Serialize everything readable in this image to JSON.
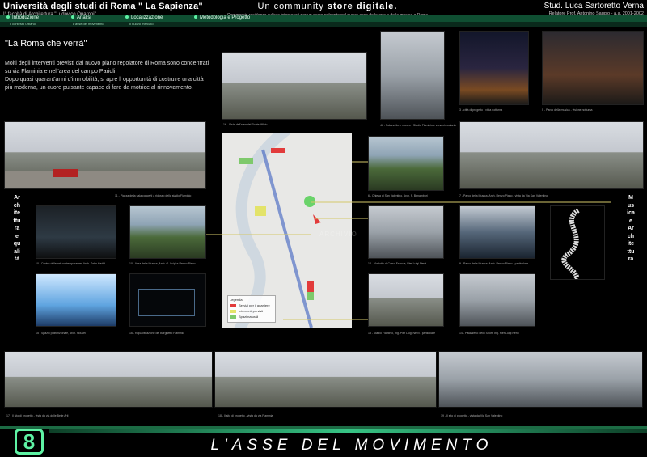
{
  "header": {
    "university": "Università degli studi di Roma \" La Sapienza\"",
    "faculty": "I° facoltà di Architettura \"Ludovico Quaroni\"",
    "center_title_a": "Un community ",
    "center_title_b": "store digitale.",
    "center_desc": "Commercio residenza cultura intersecati per un cuore pulsante nel nuovo asse delle arte e della musica a Roma",
    "author": "Stud. Luca Sartoretto Verna",
    "relatore": "Relatore Prof. Antonino Saggio - a.a. 2001-2002"
  },
  "nav": {
    "items": [
      {
        "label": "Introduzione"
      },
      {
        "label": "Analisi"
      },
      {
        "label": "Localizzazione"
      },
      {
        "label": "Metodologia e Progetto"
      }
    ],
    "sub": [
      "Il contesto urbano",
      "L'asse del movimento",
      "Il nuovo mercato"
    ]
  },
  "main": {
    "title": "\"La Roma che verrà\"",
    "p1": "Molti degli interventi previsti dal nuovo piano regolatore di Roma sono concentrati su via Flaminia e nell'area del campo Parioli.",
    "p2": "Dopo quasi quarant'anni d'immobilità, si apre l' opportunità di costruire una città più moderna, un cuore pulsante capace di fare da motrice al rinnovamento."
  },
  "side": {
    "left_text": "Architettura e qualità",
    "right_text": "Musica e Architettura"
  },
  "captions": {
    "c1": "1b - Vista dell'area del Ponte Milvio",
    "c2": "4b - Palazzetto e museo - Stadio Flaminio e zona circostante",
    "c3": "3 - città di progetto - vista notturna",
    "c4": "5 - Parco della musica - visione notturna",
    "c5": "11 - Piazza della sala concerti a ridosso della stadio Flaminio",
    "c6": "6 - Chiesa di San Valentino, Arch. F. Benamburi",
    "c7": "7 - Parco della Musica, Arch. Renzo Piano - vista da Via San Valentino",
    "c8": "8 - Ponte della Musica, Arch. Zaha Hadid",
    "c9": "9 - Parco della Musica, Arch. Renzo Piano - particolare",
    "c10": "10 - Centro delle arti contemporanee, Arch. Zaha Hadid",
    "c11": "10 - Area della Musica, Arch. O. Luigi e Renzo Piano",
    "c12": "12 - Viadotto di Corso Francia, Pier Luigi Nervi",
    "c13": "13 - Stadio Flaminio, Ing. Pier Luigi Nervi - particolare",
    "c14": "14 - Palazzetto dello Sport, Ing. Pier Luigi Nervi",
    "c15": "15 - Spazio polifunzionale, Arch. Nouvel",
    "c16": "16 - Riqualificazione del Borghetto Flaminio",
    "p1": "17 - Il sito di progetto - vista da via delle Belle Arti",
    "p2": "18 - Il sito di progetto - vista da via Flaminia",
    "p3": "19 - Il sito di progetto - vista da Via San Valentino"
  },
  "legend": {
    "title": "Legenda",
    "items": [
      "Servizi per il quartiere",
      "Interventi previsti",
      "Spazi naturali"
    ]
  },
  "watermark": "ARCHIVIO",
  "footer": {
    "number": "8",
    "title": "L'ASSE DEL MOVIMENTO"
  },
  "colors": {
    "accent": "#5ef2a4",
    "nav_green": "#0f4f32"
  }
}
